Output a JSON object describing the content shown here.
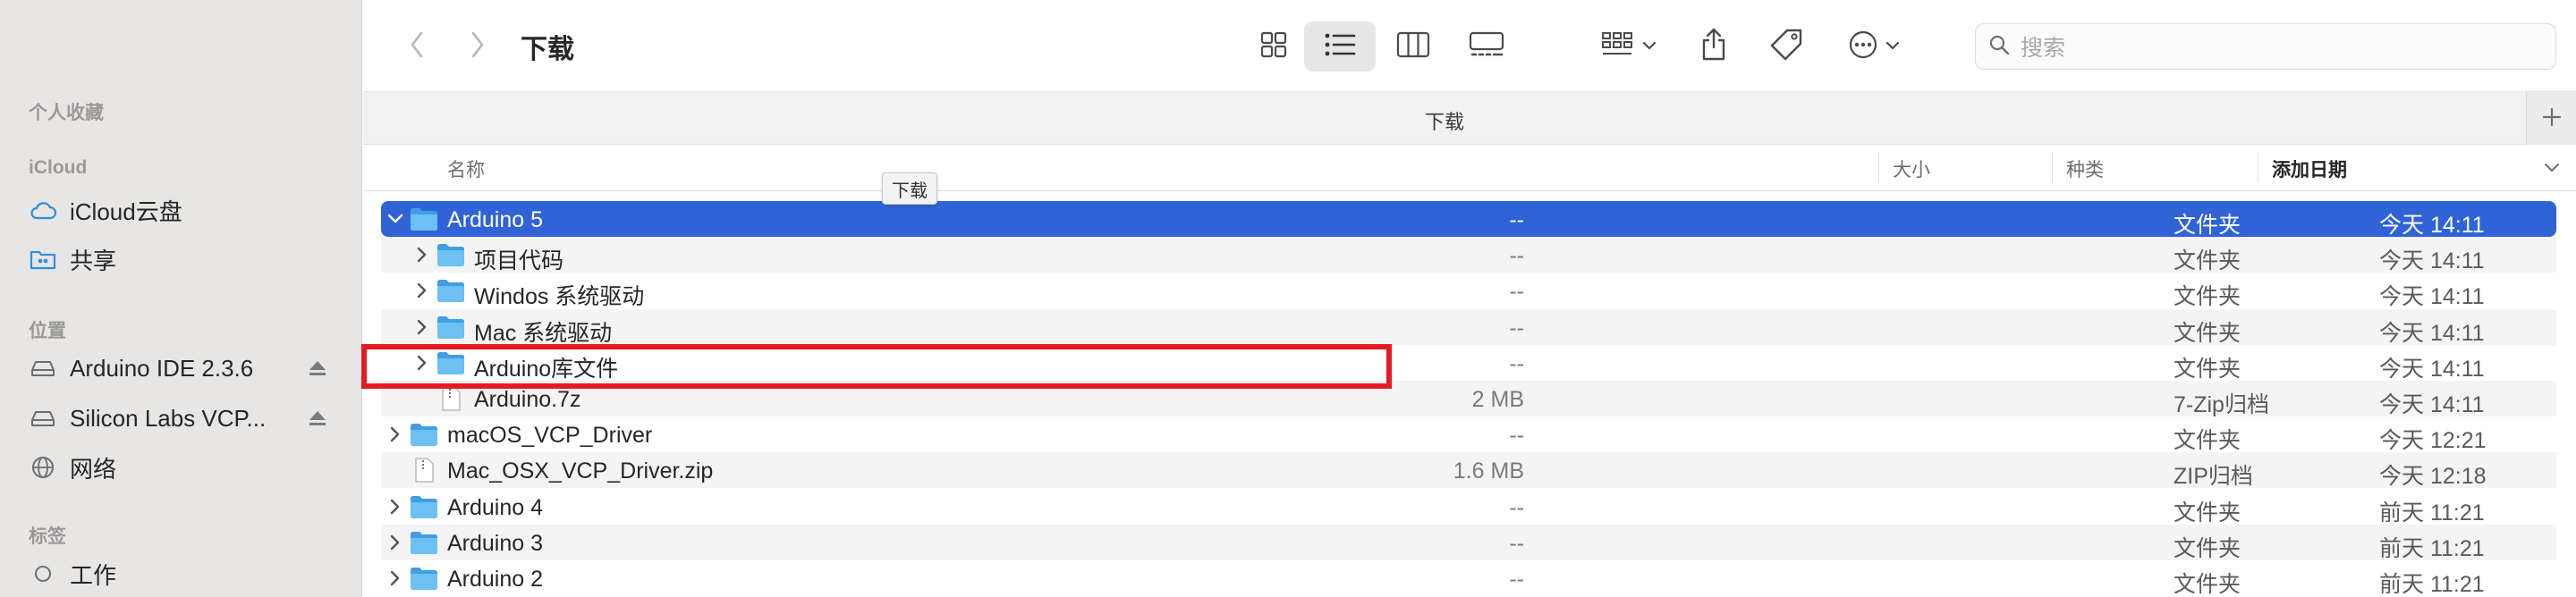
{
  "window": {
    "title": "下载",
    "path_label": "下载",
    "tooltip": "下载"
  },
  "sidebar": {
    "favorites_header": "个人收藏",
    "icloud_header": "iCloud",
    "icloud_items": [
      {
        "label": "iCloud云盘",
        "icon": "cloud-icon"
      },
      {
        "label": "共享",
        "icon": "shared-folder-icon"
      }
    ],
    "locations_header": "位置",
    "location_items": [
      {
        "label": "Arduino IDE 2.3.6",
        "icon": "drive-icon",
        "eject": true
      },
      {
        "label": "Silicon Labs VCP...",
        "icon": "drive-icon",
        "eject": true
      },
      {
        "label": "网络",
        "icon": "network-globe-icon",
        "eject": false
      }
    ],
    "tags_header": "标签",
    "tag_items": [
      {
        "label": "工作",
        "icon": "tag-circle-icon"
      }
    ]
  },
  "toolbar": {
    "search_placeholder": "搜索"
  },
  "columns": {
    "name": "名称",
    "size": "大小",
    "kind": "种类",
    "date": "添加日期"
  },
  "rows": [
    {
      "name": "Arduino 5",
      "size": "--",
      "kind": "文件夹",
      "date": "今天 14:11",
      "type": "folder",
      "expanded": true,
      "indent": 0,
      "selected": true
    },
    {
      "name": "项目代码",
      "size": "--",
      "kind": "文件夹",
      "date": "今天 14:11",
      "type": "folder",
      "expanded": false,
      "indent": 1,
      "selected": false
    },
    {
      "name": "Windos 系统驱动",
      "size": "--",
      "kind": "文件夹",
      "date": "今天 14:11",
      "type": "folder",
      "expanded": false,
      "indent": 1,
      "selected": false
    },
    {
      "name": "Mac 系统驱动",
      "size": "--",
      "kind": "文件夹",
      "date": "今天 14:11",
      "type": "folder",
      "expanded": false,
      "indent": 1,
      "selected": false
    },
    {
      "name": "Arduino库文件",
      "size": "--",
      "kind": "文件夹",
      "date": "今天 14:11",
      "type": "folder",
      "expanded": false,
      "indent": 1,
      "selected": false
    },
    {
      "name": "Arduino.7z",
      "size": "2 MB",
      "kind": "7-Zip归档",
      "date": "今天 14:11",
      "type": "file",
      "indent": 1,
      "selected": false
    },
    {
      "name": "macOS_VCP_Driver",
      "size": "--",
      "kind": "文件夹",
      "date": "今天 12:21",
      "type": "folder",
      "expanded": false,
      "indent": 0,
      "selected": false
    },
    {
      "name": "Mac_OSX_VCP_Driver.zip",
      "size": "1.6 MB",
      "kind": "ZIP归档",
      "date": "今天 12:18",
      "type": "file",
      "indent": 0,
      "selected": false
    },
    {
      "name": "Arduino 4",
      "size": "--",
      "kind": "文件夹",
      "date": "前天 11:21",
      "type": "folder",
      "expanded": false,
      "indent": 0,
      "selected": false
    },
    {
      "name": "Arduino 3",
      "size": "--",
      "kind": "文件夹",
      "date": "前天 11:21",
      "type": "folder",
      "expanded": false,
      "indent": 0,
      "selected": false
    },
    {
      "name": "Arduino 2",
      "size": "--",
      "kind": "文件夹",
      "date": "前天 11:21",
      "type": "folder",
      "expanded": false,
      "indent": 0,
      "selected": false
    }
  ],
  "colors": {
    "selection": "#2f63d6",
    "folder": "#5ab4ee",
    "highlight_box": "#e51b24"
  }
}
